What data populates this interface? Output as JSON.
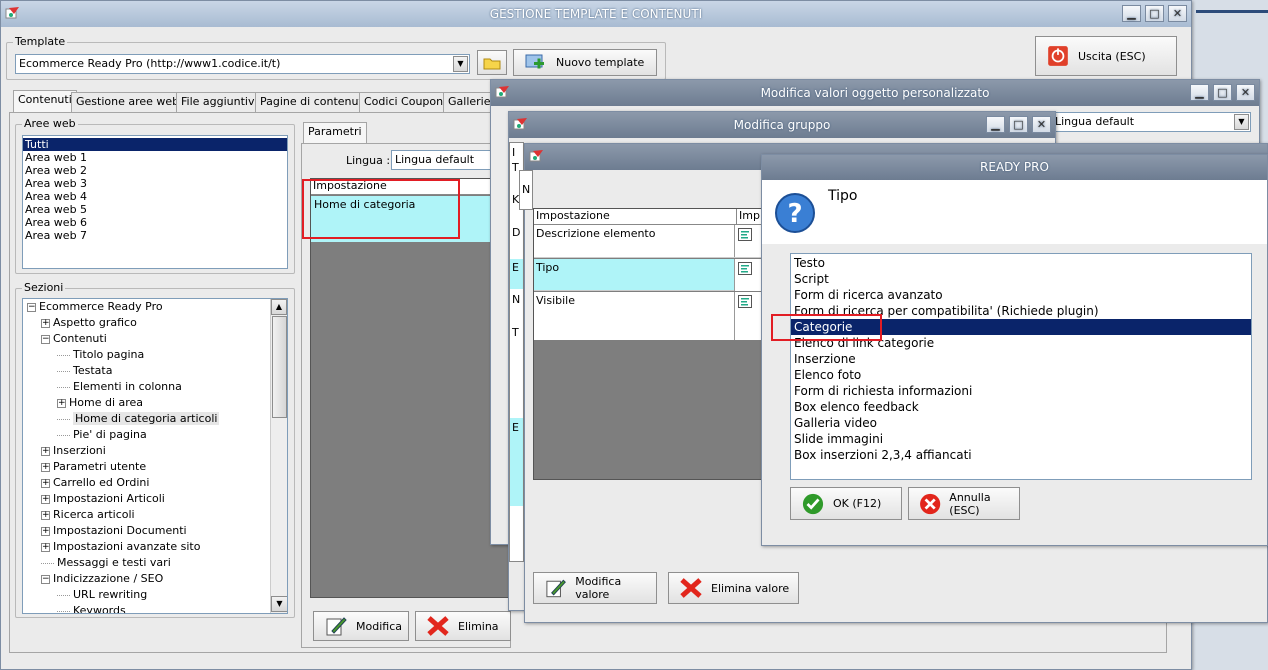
{
  "main": {
    "title": "GESTIONE TEMPLATE E CONTENUTI",
    "template_label": "Template",
    "template_value": "Ecommerce Ready Pro (http://www1.codice.it/t)",
    "new_template": "Nuovo template",
    "exit": "Uscita (ESC)",
    "tabs": [
      "Contenuti",
      "Gestione aree web",
      "File aggiuntivi",
      "Pagine di contenuti",
      "Codici Coupon",
      "Gallerie d"
    ],
    "areas_label": "Aree web",
    "areas": [
      "Tutti",
      "Area web 1",
      "Area web 2",
      "Area web 3",
      "Area web 4",
      "Area web 5",
      "Area web 6",
      "Area web 7"
    ],
    "sections_label": "Sezioni",
    "tree": [
      {
        "label": "Ecommerce Ready Pro",
        "sign": "−"
      },
      {
        "label": "Aspetto grafico",
        "sign": "+"
      },
      {
        "label": "Contenuti",
        "sign": "−"
      },
      {
        "label": "Titolo pagina",
        "sign": ""
      },
      {
        "label": "Testata",
        "sign": ""
      },
      {
        "label": "Elementi in colonna",
        "sign": ""
      },
      {
        "label": "Home di area",
        "sign": "+"
      },
      {
        "label": "Home di categoria articoli",
        "sign": ""
      },
      {
        "label": "Pie' di pagina",
        "sign": ""
      },
      {
        "label": "Inserzioni",
        "sign": "+"
      },
      {
        "label": "Parametri utente",
        "sign": "+"
      },
      {
        "label": "Carrello ed Ordini",
        "sign": "+"
      },
      {
        "label": "Impostazioni Articoli",
        "sign": "+"
      },
      {
        "label": "Ricerca articoli",
        "sign": "+"
      },
      {
        "label": "Impostazioni Documenti",
        "sign": "+"
      },
      {
        "label": "Impostazioni avanzate sito",
        "sign": "+"
      },
      {
        "label": "Messaggi e testi vari",
        "sign": ""
      },
      {
        "label": "Indicizzazione / SEO",
        "sign": "−"
      },
      {
        "label": "URL rewriting",
        "sign": ""
      },
      {
        "label": "Keywords",
        "sign": ""
      }
    ],
    "params_tab": "Parametri",
    "lingua_label": "Lingua :",
    "lingua_value": "Lingua default",
    "grid_header": "Impostazione",
    "grid_row": "Home di categoria",
    "modify": "Modifica",
    "delete": "Elimina"
  },
  "win2": {
    "title": "Modifica valori oggetto personalizzato",
    "lingua_value": "Lingua default"
  },
  "win3": {
    "title": "Modifica gruppo",
    "col_frag": [
      "I",
      "T",
      "K",
      "D",
      "E",
      "N",
      "T",
      "E"
    ]
  },
  "win4": {
    "header_setting": "Impostazione",
    "header_imp": "Imp.g",
    "rows": [
      "Descrizione elemento",
      "Tipo",
      "Visibile"
    ],
    "modify_value": "Modifica valore",
    "delete_value": "Elimina valore",
    "frag_n": "N"
  },
  "dialog": {
    "title": "READY PRO",
    "prompt": "Tipo",
    "options": [
      "Testo",
      "Script",
      "Form di ricerca avanzato",
      "Form di ricerca per compatibilita' (Richiede plugin)",
      "Categorie",
      "Elenco di link categorie",
      "Inserzione",
      "Elenco foto",
      "Form di richiesta informazioni",
      "Box elenco feedback",
      "Galleria video",
      "Slide immagini",
      "Box inserzioni 2,3,4 affiancati"
    ],
    "selected": "Categorie",
    "ok": "OK (F12)",
    "cancel": "Annulla (ESC)"
  },
  "colors": {
    "selection": "#0a246a",
    "highlight_row": "#aff4f8",
    "red_box": "#e21d24"
  }
}
